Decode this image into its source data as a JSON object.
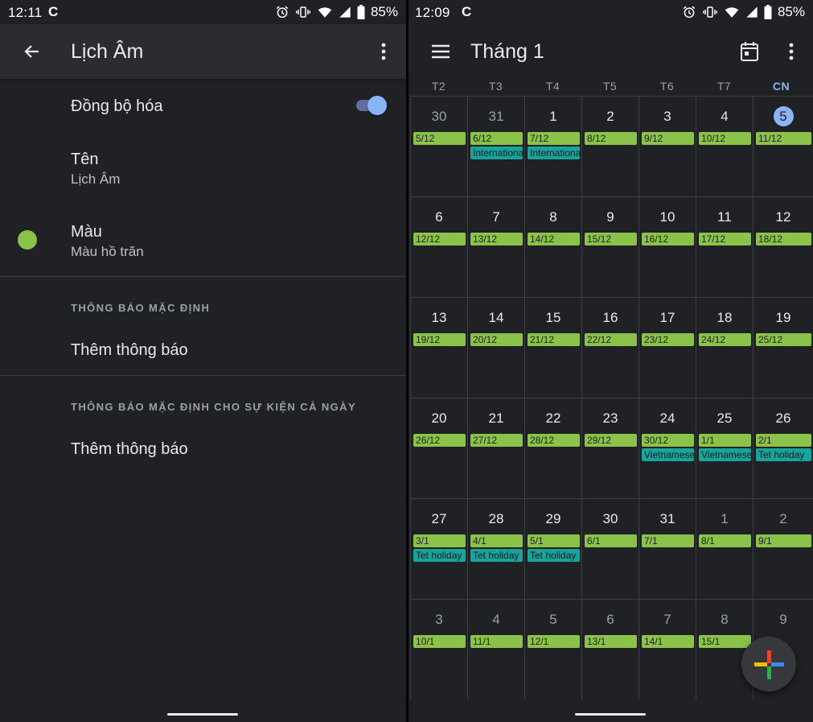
{
  "colors": {
    "background": "#202124",
    "lunar_chip": "#8bc34a",
    "holiday_chip": "#1aa39a",
    "accent": "#8ab4f8",
    "selected_color": "#8bc34a"
  },
  "left": {
    "status": {
      "time": "12:11",
      "app_icon": "C",
      "battery": "85%"
    },
    "appbar": {
      "title": "Lịch Âm",
      "back_icon": "arrow-left-icon",
      "menu_icon": "more-vert-icon"
    },
    "sync": {
      "label": "Đồng bộ hóa",
      "enabled": true
    },
    "name": {
      "label": "Tên",
      "value": "Lịch Âm"
    },
    "color": {
      "label": "Màu",
      "value": "Màu hồ trăn"
    },
    "default_notification": {
      "header": "THÔNG BÁO MẶC ĐỊNH",
      "add_label": "Thêm thông báo"
    },
    "allday_notification": {
      "header": "THÔNG BÁO MẶC ĐỊNH CHO SỰ KIỆN CẢ NGÀY",
      "add_label": "Thêm thông báo"
    }
  },
  "right": {
    "status": {
      "time": "12:09",
      "app_icon": "C",
      "battery": "85%"
    },
    "appbar": {
      "title": "Tháng 1",
      "menu_icon": "hamburger-icon",
      "today_icon": "calendar-today-icon",
      "more_icon": "more-vert-icon"
    },
    "weekdays": [
      "T2",
      "T3",
      "T4",
      "T5",
      "T6",
      "T7",
      "CN"
    ],
    "today_weekday_index": 6,
    "weeks": [
      [
        {
          "day": "30",
          "lunar": "5/12",
          "dim": true
        },
        {
          "day": "31",
          "lunar": "6/12",
          "dim": true,
          "event": "International"
        },
        {
          "day": "1",
          "lunar": "7/12",
          "event": "International"
        },
        {
          "day": "2",
          "lunar": "8/12"
        },
        {
          "day": "3",
          "lunar": "9/12"
        },
        {
          "day": "4",
          "lunar": "10/12"
        },
        {
          "day": "5",
          "lunar": "11/12",
          "today": true
        }
      ],
      [
        {
          "day": "6",
          "lunar": "12/12"
        },
        {
          "day": "7",
          "lunar": "13/12"
        },
        {
          "day": "8",
          "lunar": "14/12"
        },
        {
          "day": "9",
          "lunar": "15/12"
        },
        {
          "day": "10",
          "lunar": "16/12"
        },
        {
          "day": "11",
          "lunar": "17/12"
        },
        {
          "day": "12",
          "lunar": "18/12"
        }
      ],
      [
        {
          "day": "13",
          "lunar": "19/12"
        },
        {
          "day": "14",
          "lunar": "20/12"
        },
        {
          "day": "15",
          "lunar": "21/12"
        },
        {
          "day": "16",
          "lunar": "22/12"
        },
        {
          "day": "17",
          "lunar": "23/12"
        },
        {
          "day": "18",
          "lunar": "24/12"
        },
        {
          "day": "19",
          "lunar": "25/12"
        }
      ],
      [
        {
          "day": "20",
          "lunar": "26/12"
        },
        {
          "day": "21",
          "lunar": "27/12"
        },
        {
          "day": "22",
          "lunar": "28/12"
        },
        {
          "day": "23",
          "lunar": "29/12"
        },
        {
          "day": "24",
          "lunar": "30/12",
          "event": "Vietnamese"
        },
        {
          "day": "25",
          "lunar": "1/1",
          "event": "Vietnamese"
        },
        {
          "day": "26",
          "lunar": "2/1",
          "event": "Tet holiday"
        }
      ],
      [
        {
          "day": "27",
          "lunar": "3/1",
          "event": "Tet holiday"
        },
        {
          "day": "28",
          "lunar": "4/1",
          "event": "Tet holiday"
        },
        {
          "day": "29",
          "lunar": "5/1",
          "event": "Tet holiday"
        },
        {
          "day": "30",
          "lunar": "6/1"
        },
        {
          "day": "31",
          "lunar": "7/1"
        },
        {
          "day": "1",
          "lunar": "8/1",
          "dim": true
        },
        {
          "day": "2",
          "lunar": "9/1",
          "dim": true
        }
      ],
      [
        {
          "day": "3",
          "lunar": "10/1",
          "dim": true
        },
        {
          "day": "4",
          "lunar": "11/1",
          "dim": true
        },
        {
          "day": "5",
          "lunar": "12/1",
          "dim": true
        },
        {
          "day": "6",
          "lunar": "13/1",
          "dim": true
        },
        {
          "day": "7",
          "lunar": "14/1",
          "dim": true
        },
        {
          "day": "8",
          "lunar": "15/1",
          "dim": true
        },
        {
          "day": "9",
          "lunar": "",
          "dim": true
        }
      ]
    ],
    "fab_icon": "plus-multicolor-icon"
  }
}
